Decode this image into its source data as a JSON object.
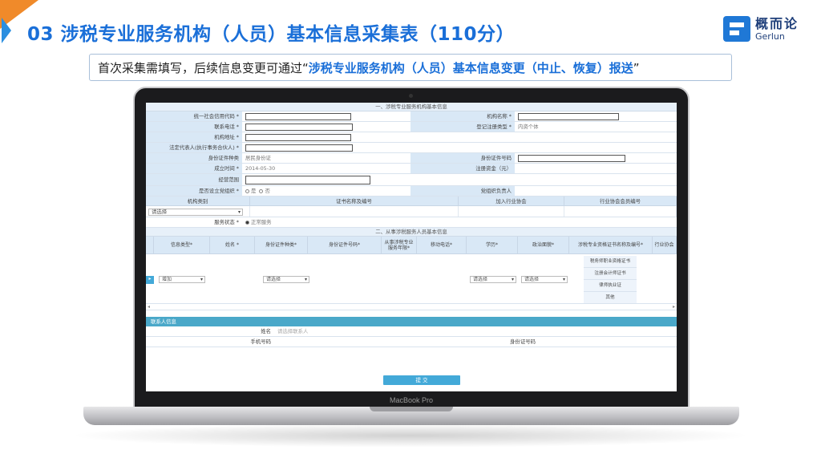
{
  "slide": {
    "title": "03 涉税专业服务机构（人员）基本信息采集表（110分）",
    "note_prefix": "首次采集需填写，后续信息变更可通过“",
    "note_highlight": "涉税专业服务机构（人员）基本信息变更（中止、恢复）报送",
    "note_suffix": "”",
    "logo_cn": "概而论",
    "logo_en": "Gerlun",
    "accent_color": "#1a6fd8",
    "corner_color": "#f08a2a"
  },
  "laptop": {
    "brand": "MacBook Pro"
  },
  "form": {
    "section1_title": "一、涉税专业服务机构基本信息",
    "credit_code_label": "统一社会信用代码 *",
    "org_name_label": "机构名称 *",
    "phone_label": "联系电话 *",
    "reg_type_label": "登记注册类型 *",
    "reg_type_value": "内资个体",
    "address_label": "机构地址 *",
    "legal_rep_label": "法定代表人(执行事务合伙人) *",
    "id_type_label": "身份证件种类",
    "id_type_value": "居民身份证",
    "id_no_label": "身份证件号码",
    "est_date_label": "成立时间 *",
    "est_date_value": "2014-05-30",
    "capital_label": "注册资金（元）",
    "scope_label": "经营范围",
    "party_label": "是否设立党组织 *",
    "yes_label": "是",
    "no_label": "否",
    "party_leader_label": "党组织负责人",
    "cat_col": "机构类别",
    "cert_col": "证书名称及编号",
    "assoc_col": "加入行业协会",
    "member_col": "行业协会会员编号",
    "select_placeholder": "请选择",
    "service_status_label": "服务状态 *",
    "service_status_value": "正常服务",
    "section2_title": "二、从事涉税服务人员基本信息",
    "staff_cols": [
      "信息类型*",
      "姓名 *",
      "身份证件种类*",
      "身份证件号码*",
      "从事涉税专业服务年限*",
      "移动电话*",
      "学历*",
      "政治面貌*",
      "涉税专业资格证书名称及编号*",
      "行业协会"
    ],
    "row_add": "增加",
    "certs": [
      "税务师职业资格证书",
      "注册会计师证书",
      "律师执业证",
      "其他"
    ],
    "contact_title": "联系人信息",
    "contact_name_label": "姓名",
    "contact_name_placeholder": "请选择联系人",
    "mobile_label": "手机号码",
    "contact_id_label": "身份证号码",
    "submit_label": "提 交"
  }
}
